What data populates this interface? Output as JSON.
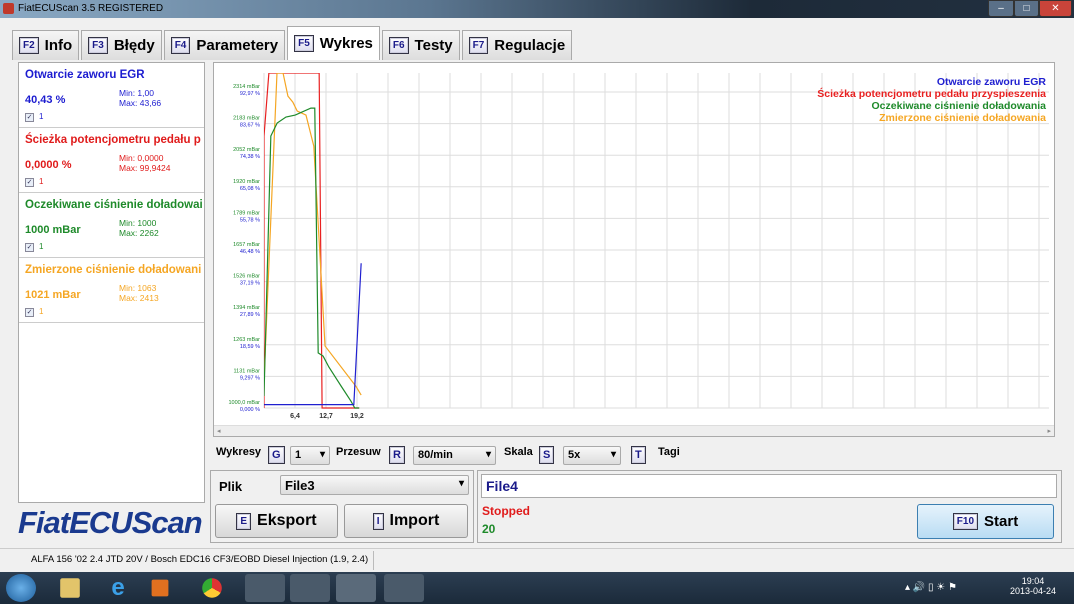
{
  "window": {
    "title": "FiatECUScan 3.5 REGISTERED"
  },
  "tabs": [
    {
      "key": "F2",
      "label": "Info"
    },
    {
      "key": "F3",
      "label": "Błędy"
    },
    {
      "key": "F4",
      "label": "Parametery"
    },
    {
      "key": "F5",
      "label": "Wykres",
      "active": true
    },
    {
      "key": "F6",
      "label": "Testy"
    },
    {
      "key": "F7",
      "label": "Regulacje"
    }
  ],
  "params": [
    {
      "name": "Otwarcie zaworu EGR",
      "value": "40,43 %",
      "min": "Min: 1,00",
      "max": "Max: 43,66",
      "check": "1",
      "color": "#1c1cd0"
    },
    {
      "name": "Ścieżka potencjometru pedału p",
      "value": "0,0000 %",
      "min": "Min: 0,0000",
      "max": "Max: 99,9424",
      "check": "1",
      "color": "#e01b1b"
    },
    {
      "name": "Oczekiwane ciśnienie doładowai",
      "value": "1000 mBar",
      "min": "Min: 1000",
      "max": "Max: 2262",
      "check": "1",
      "color": "#1e8a2a"
    },
    {
      "name": "Zmierzone ciśnienie doładowani",
      "value": "1021 mBar",
      "min": "Min: 1063",
      "max": "Max: 2413",
      "check": "1",
      "color": "#f5a623"
    }
  ],
  "logo": "FiatECUScan",
  "chart_data": {
    "type": "line",
    "xlabel": "",
    "ylabel": "",
    "x_ticks": [
      "6,4",
      "12,7",
      "19,2"
    ],
    "x_tick_values": [
      6.35,
      12.7,
      19.05
    ],
    "xlim": [
      0,
      160
    ],
    "y_ticks_mbar": [
      "1000,0 mBar",
      "1131 mBar",
      "1263 mBar",
      "1394 mBar",
      "1526 mBar",
      "1657 mBar",
      "1789 mBar",
      "1920 mBar",
      "2052 mBar",
      "2183 mBar",
      "2314 mBar"
    ],
    "y_ticks_pct": [
      "0,000 %",
      "9,297 %",
      "18,59 %",
      "27,89 %",
      "37,19 %",
      "46,48 %",
      "55,78 %",
      "65,08 %",
      "74,38 %",
      "83,67 %",
      "92,97 %"
    ],
    "ylim_mbar": [
      1000,
      2393
    ],
    "ylim_pct": [
      0,
      98.6
    ],
    "grid": true,
    "legend_position": "top-right",
    "series": [
      {
        "name": "Otwarcie zaworu EGR",
        "unit": "pct",
        "color": "#2020d0",
        "points": [
          [
            0,
            1
          ],
          [
            18.4,
            1
          ],
          [
            19.9,
            42.6
          ]
        ]
      },
      {
        "name": "Ścieżka potencjometru pedału przyspieszenia",
        "unit": "pct",
        "color": "#e82020",
        "points": [
          [
            0,
            0
          ],
          [
            0,
            80
          ],
          [
            1,
            98.6
          ],
          [
            11.3,
            98.6
          ],
          [
            11.9,
            0
          ],
          [
            19.5,
            0
          ]
        ]
      },
      {
        "name": "Oczekiwane ciśnienie doładowania",
        "unit": "mbar",
        "color": "#1e8a2a",
        "points": [
          [
            0,
            1050
          ],
          [
            1.4,
            2131
          ],
          [
            2.7,
            2185
          ],
          [
            4.5,
            2210
          ],
          [
            6.4,
            2218
          ],
          [
            9.6,
            2247
          ],
          [
            10.4,
            2247
          ],
          [
            11.1,
            1229
          ],
          [
            12.1,
            1216
          ],
          [
            13.3,
            1170
          ],
          [
            15.8,
            1091
          ],
          [
            17.8,
            1029
          ],
          [
            18.6,
            1000
          ],
          [
            19.5,
            1000
          ]
        ]
      },
      {
        "name": "Zmierzone ciśnienie doładowania",
        "unit": "mbar",
        "color": "#f5a623",
        "points": [
          [
            0,
            1112
          ],
          [
            2.66,
            2393
          ],
          [
            3.9,
            2393
          ],
          [
            4.9,
            2297
          ],
          [
            5.9,
            2272
          ],
          [
            6.8,
            2235
          ],
          [
            8.6,
            2218
          ],
          [
            10.2,
            2089
          ],
          [
            11.3,
            1694
          ],
          [
            12.5,
            1258
          ],
          [
            18.8,
            1091
          ],
          [
            19.9,
            1054
          ]
        ]
      }
    ]
  },
  "controls": {
    "wykresy_label": "Wykresy",
    "wykresy_key": "G",
    "wykresy_value": "1",
    "przesuw_label": "Przesuw",
    "przesuw_key": "R",
    "przesuw_value": "80/min",
    "skala_label": "Skala",
    "skala_key": "S",
    "skala_value": "5x",
    "tagi_key": "T",
    "tagi_label": "Tagi"
  },
  "file": {
    "plik_label": "Plik",
    "plik_value": "File3",
    "export_key": "E",
    "export_label": "Eksport",
    "import_key": "I",
    "import_label": "Import"
  },
  "recording": {
    "filename": "File4",
    "status": "Stopped",
    "count": "20",
    "start_key": "F10",
    "start_label": "Start"
  },
  "statusbar": {
    "vehicle": "ALFA 156 '02 2.4 JTD 20V / Bosch EDC16 CF3/EOBD Diesel Injection (1.9, 2.4)"
  },
  "taskbar": {
    "time": "19:04",
    "date": "2013-04-24"
  }
}
